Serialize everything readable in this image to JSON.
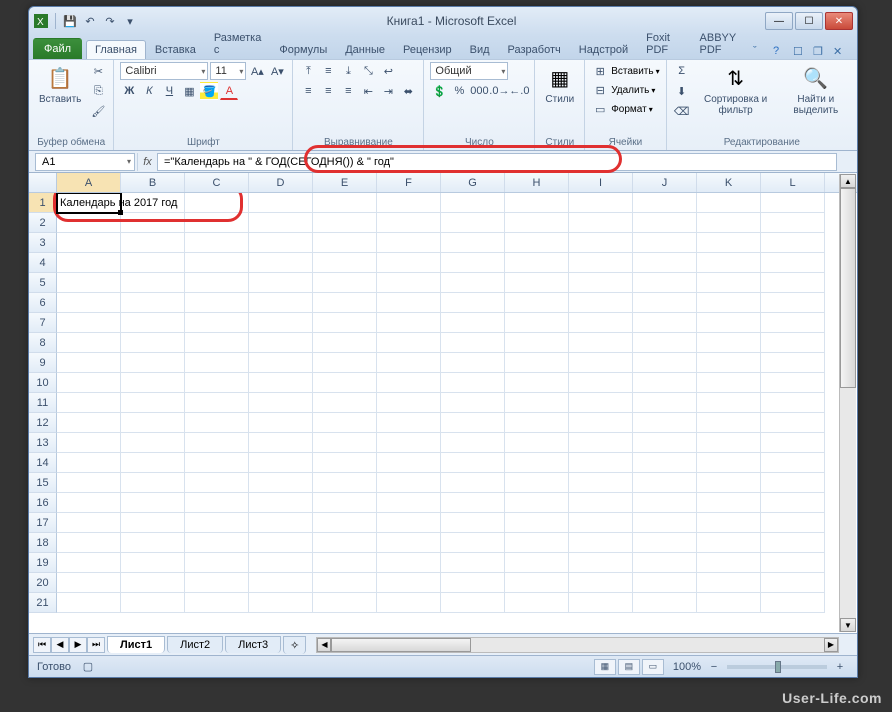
{
  "title": "Книга1 - Microsoft Excel",
  "tabs": {
    "file": "Файл",
    "items": [
      "Главная",
      "Вставка",
      "Разметка с",
      "Формулы",
      "Данные",
      "Рецензир",
      "Вид",
      "Разработч",
      "Надстрой",
      "Foxit PDF",
      "ABBYY PDF"
    ],
    "active": 0
  },
  "ribbon": {
    "clipboard": {
      "label": "Буфер обмена",
      "paste": "Вставить"
    },
    "font": {
      "label": "Шрифт",
      "name": "Calibri",
      "size": "11"
    },
    "alignment": {
      "label": "Выравнивание"
    },
    "number": {
      "label": "Число",
      "format": "Общий"
    },
    "styles": {
      "label": "Стили",
      "btn": "Стили"
    },
    "cells": {
      "label": "Ячейки",
      "insert": "Вставить",
      "delete": "Удалить",
      "format": "Формат"
    },
    "editing": {
      "label": "Редактирование",
      "sort": "Сортировка и фильтр",
      "find": "Найти и выделить"
    }
  },
  "namebox": "A1",
  "formula": "=\"Календарь на \" & ГОД(СЕГОДНЯ()) & \" год\"",
  "columns": [
    "A",
    "B",
    "C",
    "D",
    "E",
    "F",
    "G",
    "H",
    "I",
    "J",
    "K",
    "L"
  ],
  "rowcount": 21,
  "cellA1": "Календарь на 2017 год",
  "sheets": [
    "Лист1",
    "Лист2",
    "Лист3"
  ],
  "activeSheet": 0,
  "status": "Готово",
  "zoom": "100%",
  "watermark": "User-Life.com"
}
